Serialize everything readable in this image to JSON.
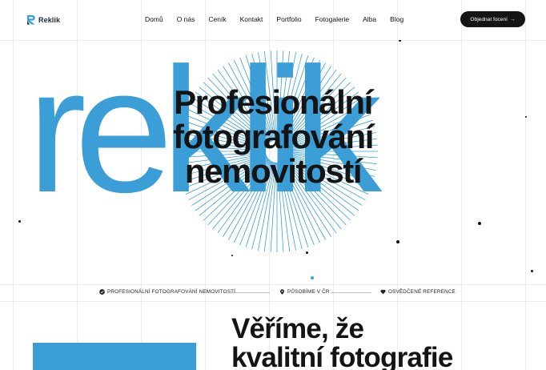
{
  "brand": {
    "name": "Reklik"
  },
  "nav": {
    "items": [
      "Domů",
      "O nás",
      "Ceník",
      "Kontakt",
      "Portfolio",
      "Fotogalerie",
      "Alba",
      "Blog"
    ]
  },
  "cta": {
    "label": "Objednat focení",
    "arrow": "→"
  },
  "hero": {
    "background_word": "reklik",
    "title_lines": [
      "Profesionální",
      "fotografování",
      "nemovitostí"
    ]
  },
  "features": [
    {
      "icon": "check-circle-icon",
      "label": "PROFESIONÁLNÍ FOTOGRAFOVÁNÍ NEMOVITOSTÍ"
    },
    {
      "icon": "location-pin-icon",
      "label": "PŮSOBÍME V ČR"
    },
    {
      "icon": "heart-icon",
      "label": "OSVĚDČENÉ REFERENCE"
    }
  ],
  "section": {
    "title_lines": [
      "Věříme, že",
      "kvalitní fotografie"
    ]
  },
  "colors": {
    "accent": "#3b9ed6",
    "dark": "#141414",
    "background": "#ffffff"
  }
}
